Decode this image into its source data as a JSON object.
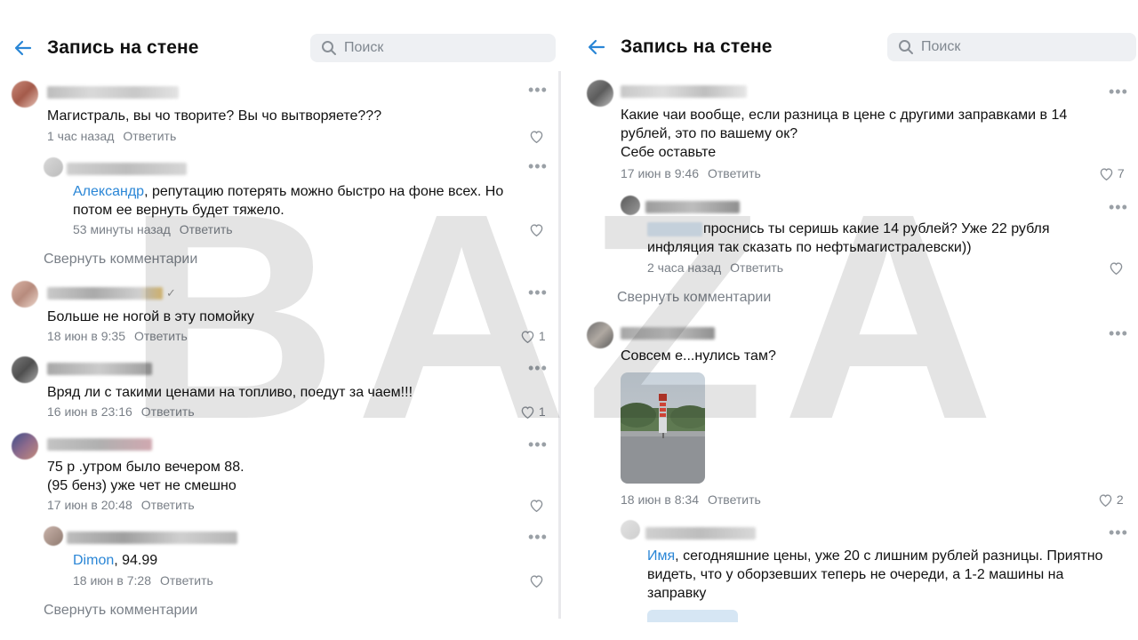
{
  "colors": {
    "accent": "#2a86d6",
    "secondary_text": "#7a8088",
    "search_bg": "#eef0f3"
  },
  "watermark": "BAZA",
  "left": {
    "header": {
      "title": "Запись на стене",
      "search_placeholder": "Поиск",
      "back_icon": "arrow-left-icon"
    },
    "comments": [
      {
        "text": "Магистраль, вы чо творите? Вы чо вытворяете???",
        "time": "1 час назад",
        "reply": "Ответить",
        "likes": ""
      },
      {
        "mention": "Александр",
        "text_line1": ", репутацию потерять можно быстро на фоне всех. Но",
        "text_line2": "потом ее вернуть будет тяжело.",
        "time": "53 минуты назад",
        "reply": "Ответить",
        "likes": ""
      },
      {
        "text": "Больше не ногой в эту помойку",
        "time": "18 июн в 9:35",
        "reply": "Ответить",
        "likes": "1"
      },
      {
        "text": "Вряд ли с такими ценами на топливо, поедут за чаем!!!",
        "time": "16 июн в 23:16",
        "reply": "Ответить",
        "likes": "1"
      },
      {
        "text_line1": "75 р .утром было вечером 88.",
        "text_line2": "(95 бенз) уже чет не смешно",
        "time": "17 июн в 20:48",
        "reply": "Ответить",
        "likes": ""
      },
      {
        "mention": "Dimon",
        "text": ", 94.99",
        "time": "18 июн в 7:28",
        "reply": "Ответить",
        "likes": ""
      }
    ],
    "collapse_1": "Свернуть комментарии",
    "collapse_2": "Свернуть комментарии"
  },
  "right": {
    "header": {
      "title": "Запись на стене",
      "search_placeholder": "Поиск",
      "back_icon": "arrow-left-icon"
    },
    "comments": [
      {
        "text_line1": "Какие чаи вообще, если разница в цене с другими заправками в 14",
        "text_line2": "рублей, это по вашему ок?",
        "text_line3": "Себе оставьте",
        "time": "17 июн в 9:46",
        "reply": "Ответить",
        "likes": "7"
      },
      {
        "text_line1": "проснись ты серишь какие 14 рублей? Уже 22 рубля",
        "text_line2": "инфляция так сказать по нефтьмагистралевски))",
        "time": "2 часа назад",
        "reply": "Ответить",
        "likes": ""
      },
      {
        "text": "Совсем е...нулись там?",
        "time": "18 июн в 8:34",
        "reply": "Ответить",
        "likes": "2"
      },
      {
        "mention": "Имя",
        "text_line1": ", сегодняшние цены, уже 20 с лишним рублей разницы. Приятно",
        "text_line2": "видеть, что у оборзевших теперь не очереди, а 1-2 машины на",
        "text_line3": "заправку",
        "time": "",
        "reply": "",
        "likes": ""
      }
    ],
    "collapse_1": "Свернуть комментарии"
  }
}
